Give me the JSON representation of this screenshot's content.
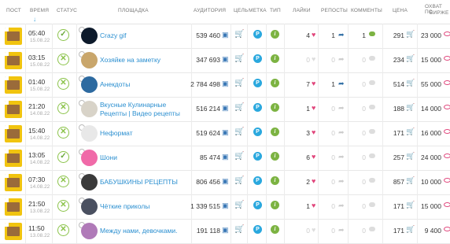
{
  "headers": {
    "post": "ПОСТ",
    "time": "ВРЕМЯ",
    "status": "СТАТУС",
    "platform": "ПЛОЩАДКА",
    "audience": "АУДИТОРИЯ",
    "goal": "ЦЕЛЬ",
    "label": "МЕТКА",
    "type": "ТИП",
    "likes": "ЛАЙКИ",
    "reposts": "РЕПОСТЫ",
    "comments": "КОММЕНТЫ",
    "price": "ЦЕНА",
    "reach_line1": "ОХВАТ ПО",
    "reach_line2": "БИРЖЕ",
    "sort_icon": "arrow-down-icon"
  },
  "colors": {
    "accent": "#2b8fd0",
    "status_green": "#8bc34a",
    "pink": "#e0457b",
    "p_badge": "#2aa8de",
    "i_badge": "#7cb342"
  },
  "rows": [
    {
      "time": "05:40",
      "date": "15.08.22",
      "status": "ok",
      "name": "Crazy gif",
      "name2": "",
      "audience": "539 460",
      "likes": "4",
      "likes_active": true,
      "reposts": "1",
      "reposts_active": true,
      "comments": "1",
      "comments_active": true,
      "price": "291",
      "reach": "23 000",
      "avatar_color": "#0d1a2b"
    },
    {
      "time": "03:15",
      "date": "15.08.22",
      "status": "x",
      "name": "Хозяйке на заметку",
      "name2": "",
      "audience": "347 693",
      "likes": "0",
      "likes_active": false,
      "reposts": "0",
      "reposts_active": false,
      "comments": "0",
      "comments_active": false,
      "price": "234",
      "reach": "15 000",
      "avatar_color": "#c9a66b"
    },
    {
      "time": "01:40",
      "date": "15.08.22",
      "status": "x",
      "name": "Анекдоты",
      "name2": "",
      "audience": "2 784 498",
      "likes": "7",
      "likes_active": true,
      "reposts": "1",
      "reposts_active": true,
      "comments": "0",
      "comments_active": false,
      "price": "514",
      "reach": "55 000",
      "avatar_color": "#2d6aa0"
    },
    {
      "time": "21:20",
      "date": "14.08.22",
      "status": "x",
      "name": "Вкусные Кулинарные",
      "name2": "Рецепты | Видео рецепты",
      "audience": "516 214",
      "likes": "1",
      "likes_active": true,
      "reposts": "0",
      "reposts_active": false,
      "comments": "0",
      "comments_active": false,
      "price": "188",
      "reach": "14 000",
      "avatar_color": "#d8d3c8"
    },
    {
      "time": "15:40",
      "date": "14.08.22",
      "status": "x",
      "name": "Неформат",
      "name2": "",
      "audience": "519 624",
      "likes": "3",
      "likes_active": true,
      "reposts": "0",
      "reposts_active": false,
      "comments": "0",
      "comments_active": false,
      "price": "171",
      "reach": "16 000",
      "avatar_color": "#e8e8e8"
    },
    {
      "time": "13:05",
      "date": "14.08.22",
      "status": "ok",
      "name": "Шони",
      "name2": "",
      "audience": "85 474",
      "likes": "6",
      "likes_active": true,
      "reposts": "0",
      "reposts_active": false,
      "comments": "0",
      "comments_active": false,
      "price": "257",
      "reach": "24 000",
      "avatar_color": "#f06aa8"
    },
    {
      "time": "07:30",
      "date": "14.08.22",
      "status": "x",
      "name": "БАБУШКИНЫ РЕЦЕПТЫ",
      "name2": "",
      "audience": "806 456",
      "likes": "2",
      "likes_active": true,
      "reposts": "0",
      "reposts_active": false,
      "comments": "0",
      "comments_active": false,
      "price": "857",
      "reach": "10 000",
      "avatar_color": "#3a3a3a"
    },
    {
      "time": "21:50",
      "date": "13.08.22",
      "status": "x",
      "name": "Чёткие приколы",
      "name2": "",
      "audience": "1 339 515",
      "likes": "1",
      "likes_active": true,
      "reposts": "0",
      "reposts_active": false,
      "comments": "0",
      "comments_active": false,
      "price": "171",
      "reach": "15 000",
      "avatar_color": "#4a5060"
    },
    {
      "time": "11:50",
      "date": "13.08.22",
      "status": "x",
      "name": "Между нами, девочками.",
      "name2": "",
      "audience": "191 118",
      "likes": "0",
      "likes_active": false,
      "reposts": "0",
      "reposts_active": false,
      "comments": "0",
      "comments_active": false,
      "price": "171",
      "reach": "9 400",
      "avatar_color": "#b07ab8"
    }
  ]
}
